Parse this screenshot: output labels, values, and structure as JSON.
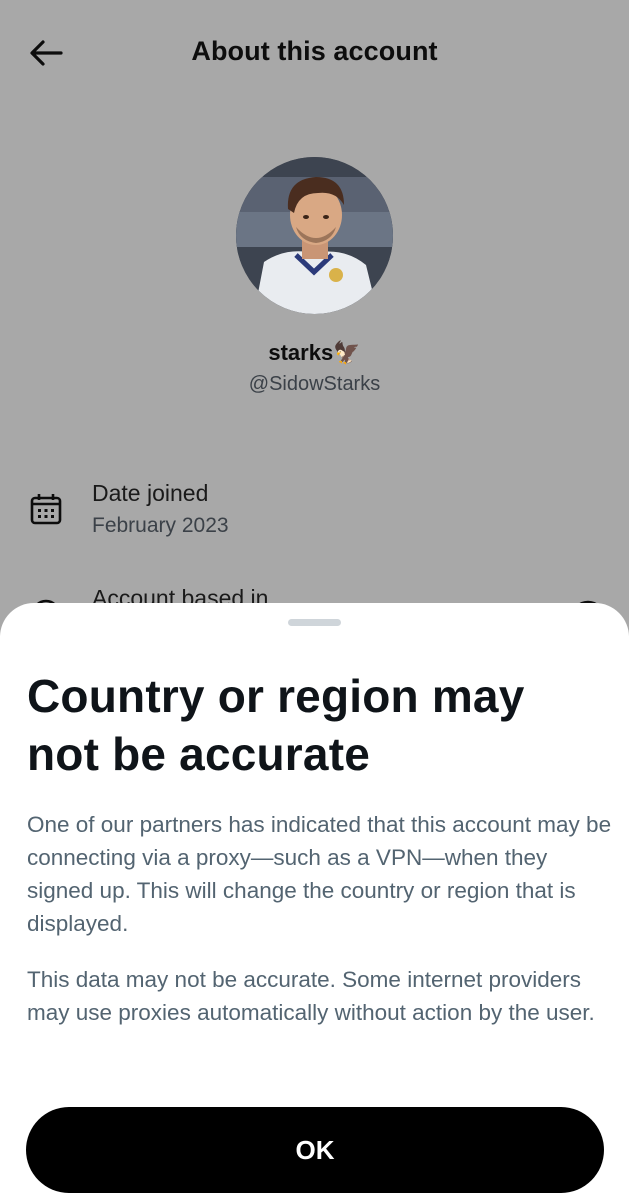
{
  "header": {
    "title": "About this account"
  },
  "profile": {
    "display_name": "starks",
    "name_emoji": "🦅",
    "handle": "@SidowStarks"
  },
  "info": [
    {
      "label": "Date joined",
      "value": "February 2023",
      "icon": "calendar-icon"
    },
    {
      "label": "Account based in",
      "value": "",
      "icon": "location-icon"
    }
  ],
  "sheet": {
    "title": "Country or region may not be accurate",
    "paragraph1": "One of our partners has indicated that this account may be connecting via a proxy—such as a VPN—when they signed up. This will change the country or region that is displayed.",
    "paragraph2": "This data may not be accurate. Some internet providers may use proxies automatically without action by the user.",
    "ok_label": "OK"
  },
  "colors": {
    "overlay_background": "#a8a8a8",
    "sheet_background": "#ffffff",
    "button_background": "#000000",
    "secondary_text": "#536471"
  }
}
